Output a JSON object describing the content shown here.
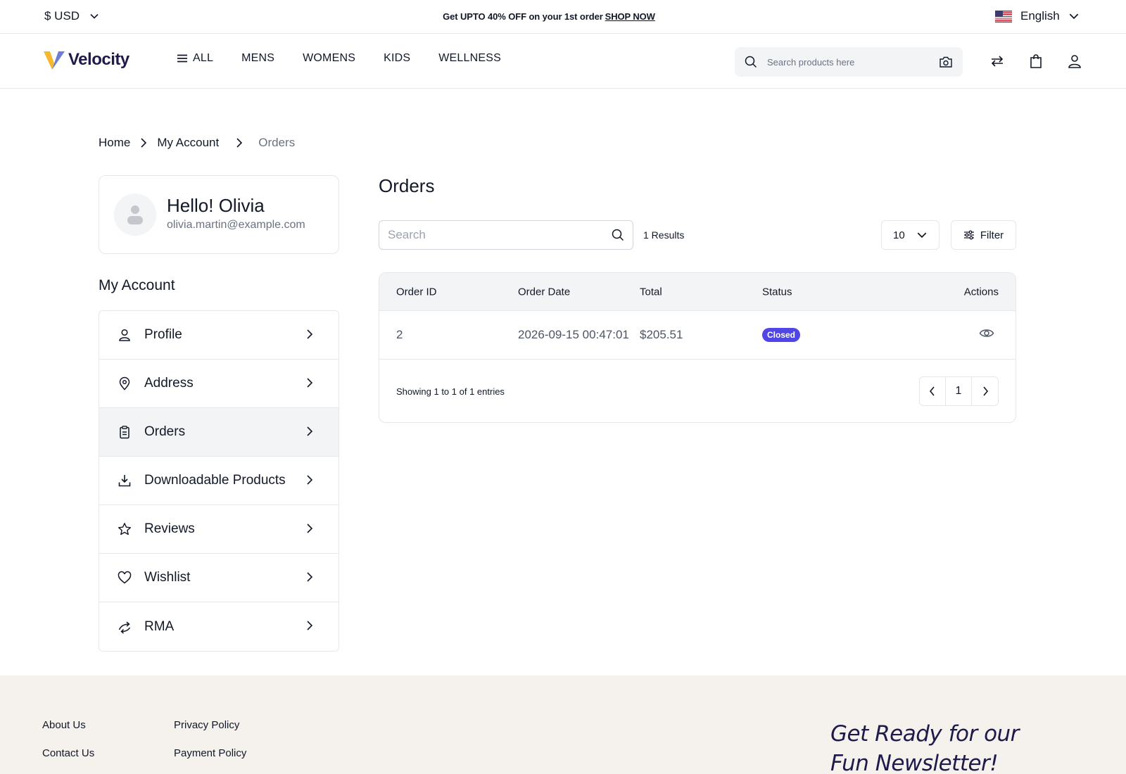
{
  "topbar": {
    "currency": "$ USD",
    "promo_text": "Get UPTO 40% OFF on your 1st order",
    "promo_link": "SHOP NOW",
    "language": "English"
  },
  "header": {
    "logo": "Velocity",
    "nav": [
      "ALL",
      "MENS",
      "WOMENS",
      "KIDS",
      "WELLNESS"
    ],
    "search_placeholder": "Search products here"
  },
  "breadcrumb": [
    "Home",
    "My Account",
    "Orders"
  ],
  "profile": {
    "greeting": "Hello! Olivia",
    "email": "olivia.martin@example.com"
  },
  "account_title": "My Account",
  "menu": [
    {
      "label": "Profile",
      "icon": "user-icon"
    },
    {
      "label": "Address",
      "icon": "location-pin-icon"
    },
    {
      "label": "Orders",
      "icon": "clipboard-icon",
      "active": true
    },
    {
      "label": "Downloadable Products",
      "icon": "download-icon"
    },
    {
      "label": "Reviews",
      "icon": "star-icon"
    },
    {
      "label": "Wishlist",
      "icon": "heart-icon"
    },
    {
      "label": "RMA",
      "icon": "return-arrows-icon"
    }
  ],
  "orders": {
    "title": "Orders",
    "search_placeholder": "Search",
    "results": "1 Results",
    "per_page": "10",
    "filter_label": "Filter",
    "columns": [
      "Order ID",
      "Order Date",
      "Total",
      "Status",
      "Actions"
    ],
    "rows": [
      {
        "id": "2",
        "date": "2026-09-15 00:47:01",
        "total": "$205.51",
        "status": "Closed"
      }
    ],
    "showing": "Showing 1 to 1 of 1 entries",
    "current_page": "1"
  },
  "footer": {
    "col1": [
      "About Us",
      "Contact Us"
    ],
    "col2": [
      "Privacy Policy",
      "Payment Policy"
    ],
    "newsletter_line1": "Get Ready for our",
    "newsletter_line2": "Fun Newsletter!"
  },
  "colors": {
    "accent": "#4f46e5",
    "brand_dark": "#1e1b4b",
    "logo_yellow": "#f5b82e",
    "footer_bg": "#f5f1ec"
  }
}
